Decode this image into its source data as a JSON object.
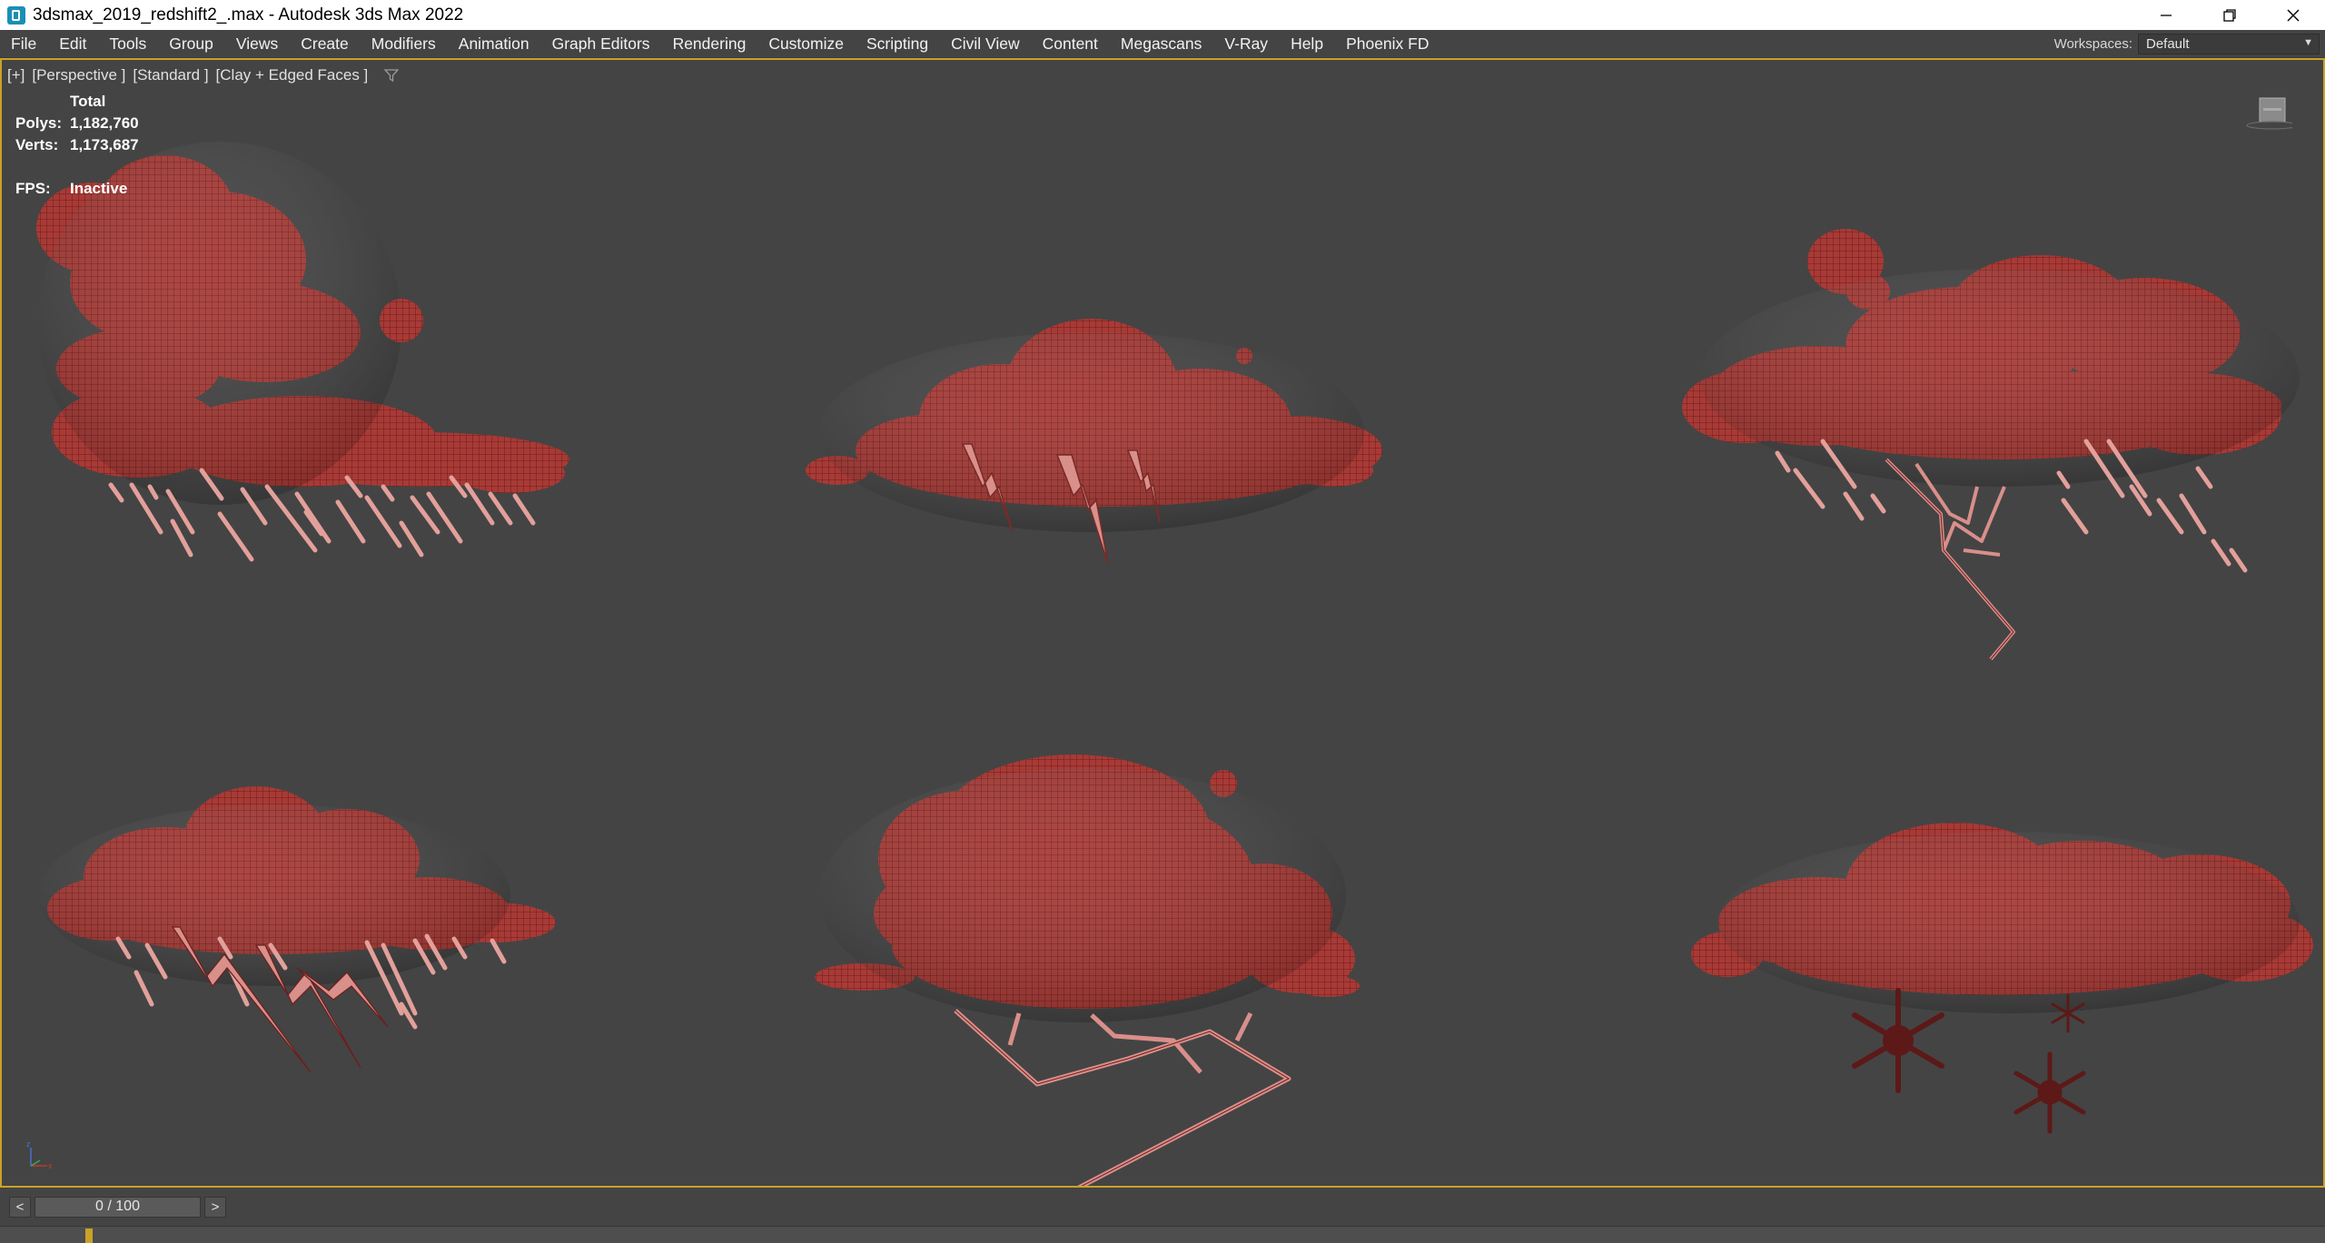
{
  "window": {
    "title": "3dsmax_2019_redshift2_.max - Autodesk 3ds Max 2022",
    "controls": [
      "minimize-icon",
      "restore-icon",
      "close-icon"
    ]
  },
  "menu": {
    "items": [
      "File",
      "Edit",
      "Tools",
      "Group",
      "Views",
      "Create",
      "Modifiers",
      "Animation",
      "Graph Editors",
      "Rendering",
      "Customize",
      "Scripting",
      "Civil View",
      "Content",
      "Megascans",
      "V-Ray",
      "Help",
      "Phoenix FD"
    ]
  },
  "workspaces": {
    "label": "Workspaces:",
    "value": "Default"
  },
  "viewport": {
    "label_plus": "[+]",
    "label_view": "[Perspective ]",
    "label_shading": "[Standard ]",
    "label_mode": "[Clay + Edged Faces ]",
    "stats": {
      "header": "Total",
      "polys_label": "Polys:",
      "polys_value": "1,182,760",
      "verts_label": "Verts:",
      "verts_value": "1,173,687",
      "fps_label": "FPS:",
      "fps_value": "Inactive"
    },
    "objects": [
      "rain cloud",
      "lightning cloud",
      "rain and lightning cloud",
      "rain and lightning cloud",
      "lightning cloud",
      "snow cloud"
    ],
    "colors": {
      "cloud": "#a83a36",
      "cloud_dark": "#6e1e1c",
      "bolt": "#d9918c",
      "border": "#c9a227"
    }
  },
  "timeline": {
    "prev": "<",
    "next": ">",
    "frame": "0 / 100"
  }
}
